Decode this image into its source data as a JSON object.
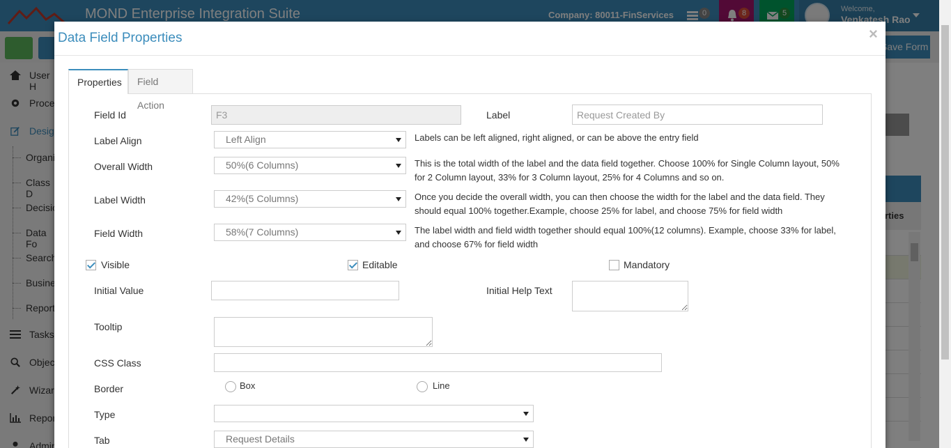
{
  "app": {
    "title": "MOND Enterprise Integration Suite",
    "company": "Company: 80011-FinServices",
    "welcome": "Welcome,",
    "user_name": "Venkatesh Rao",
    "badges": {
      "tasks": "0",
      "notifications": "8",
      "messages": "5"
    }
  },
  "subbar": {
    "save_form_label": "Save Form"
  },
  "sidebar": {
    "items": [
      {
        "label": "User H",
        "icon": "home-icon"
      },
      {
        "label": "Proces",
        "icon": "gear-icon"
      },
      {
        "label": "Design",
        "icon": "edit-icon"
      }
    ],
    "sub_items": [
      "Organis",
      "Class D",
      "Decisio",
      "Data Fo",
      "Search",
      "Busines",
      "Report"
    ],
    "items_bottom": [
      {
        "label": "Tasks",
        "icon": "list-icon"
      },
      {
        "label": "Object",
        "icon": "search-icon"
      },
      {
        "label": "Wizard",
        "icon": "wand-icon"
      },
      {
        "label": "Report",
        "icon": "bar-chart-icon"
      },
      {
        "label": "Admin",
        "icon": "user-admin-icon"
      }
    ]
  },
  "right_panel": {
    "header": "rties"
  },
  "modal": {
    "title": "Data Field Properties",
    "close": "×",
    "tabs": [
      {
        "label": "Properties",
        "active": true
      },
      {
        "label": "Field Action",
        "active": false
      }
    ],
    "form": {
      "field_id_label": "Field Id",
      "field_id_value": "F3",
      "label_label": "Label",
      "label_placeholder": "Request Created By",
      "label_align_label": "Label Align",
      "label_align_value": "Left Align",
      "label_align_help": "Labels can be left aligned, right aligned, or can be above the entry field",
      "overall_width_label": "Overall Width",
      "overall_width_value": "50%(6 Columns)",
      "overall_width_help": "This is the total width of the label and the data field together. Choose 100% for Single Column layout, 50% for 2 Column layout, 33% for 3 Column layout, 25% for 4 Columns and so on.",
      "label_width_label": "Label Width",
      "label_width_value": "42%(5 Columns)",
      "label_width_help": "Once you decide the overall width, you can then choose the width for the label and the data field. They should equal 100% together.Example, choose 25% for label, and choose 75% for field width",
      "field_width_label": "Field Width",
      "field_width_value": "58%(7 Columns)",
      "field_width_help": "The label width and field width together should equal 100%(12 columns). Example, choose 33% for label, and choose 67% for field width",
      "visible_label": "Visible",
      "visible_checked": true,
      "editable_label": "Editable",
      "editable_checked": true,
      "mandatory_label": "Mandatory",
      "mandatory_checked": false,
      "initial_value_label": "Initial Value",
      "initial_help_label": "Initial Help Text",
      "tooltip_label": "Tooltip",
      "css_class_label": "CSS Class",
      "border_label": "Border",
      "border_box_label": "Box",
      "border_line_label": "Line",
      "type_label": "Type",
      "type_value": "",
      "tab_label": "Tab",
      "tab_value": "Request Details"
    }
  },
  "colors": {
    "primary": "#3c8dbc",
    "notif_badge": "#dd4b39",
    "msg_badge": "#00a65a"
  }
}
